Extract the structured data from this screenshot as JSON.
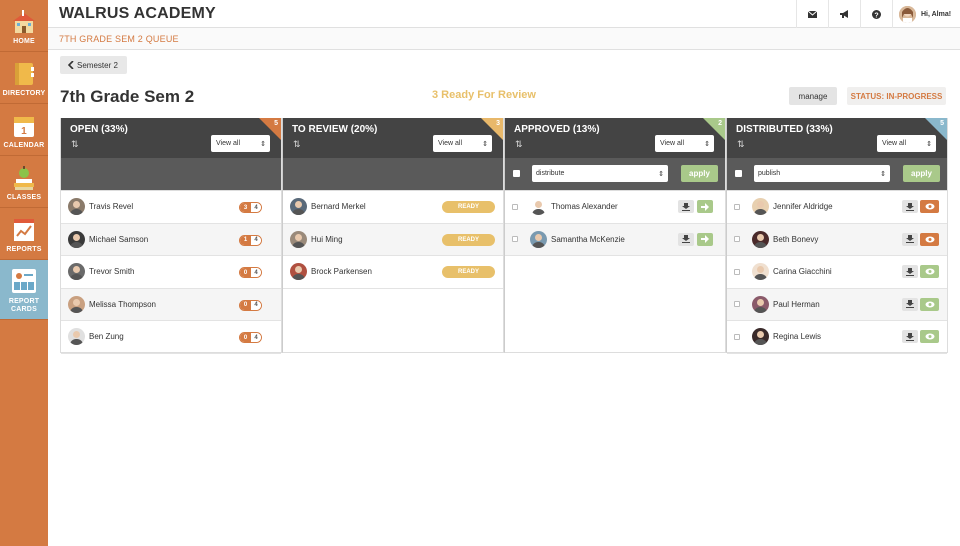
{
  "sidebar": {
    "items": [
      {
        "label": "HOME",
        "icon": "school-icon"
      },
      {
        "label": "DIRECTORY",
        "icon": "directory-icon"
      },
      {
        "label": "CALENDAR",
        "icon": "calendar-icon",
        "day": "1"
      },
      {
        "label": "CLASSES",
        "icon": "classes-icon"
      },
      {
        "label": "REPORTS",
        "icon": "reports-icon"
      },
      {
        "label": "REPORT CARDS",
        "icon": "report-cards-icon"
      }
    ]
  },
  "header": {
    "brand": "WALRUS ACADEMY",
    "greeting": "Hi, Alma!",
    "icons": [
      "mail-icon",
      "megaphone-icon",
      "help-icon"
    ]
  },
  "breadcrumb": "7TH GRADE SEM 2 QUEUE",
  "back_label": "Semester 2",
  "page_title": "7th Grade Sem 2",
  "ready_text": "3 Ready For Review",
  "manage_label": "manage",
  "status_label": "STATUS: IN-PROGRESS",
  "colors": {
    "accent": "#d47a42",
    "ready": "#e8c06a",
    "approved": "#a9c98a",
    "distributed": "#8ab8cc"
  },
  "columns": [
    {
      "title": "OPEN (33%)",
      "count": "5",
      "view": "View all",
      "rows": [
        {
          "name": "Travis Revel",
          "done": "3",
          "total": "4"
        },
        {
          "name": "Michael Samson",
          "done": "1",
          "total": "4"
        },
        {
          "name": "Trevor Smith",
          "done": "0",
          "total": "4"
        },
        {
          "name": "Melissa Thompson",
          "done": "0",
          "total": "4"
        },
        {
          "name": "Ben Zung",
          "done": "0",
          "total": "4"
        }
      ]
    },
    {
      "title": "TO REVIEW (20%)",
      "count": "3",
      "view": "View all",
      "rows": [
        {
          "name": "Bernard Merkel",
          "badge": "READY"
        },
        {
          "name": "Hui Ming",
          "badge": "READY"
        },
        {
          "name": "Brock Parkensen",
          "badge": "READY"
        }
      ]
    },
    {
      "title": "APPROVED (13%)",
      "count": "2",
      "view": "View all",
      "action": "distribute",
      "apply": "apply",
      "rows": [
        {
          "name": "Thomas Alexander"
        },
        {
          "name": "Samantha McKenzie"
        }
      ]
    },
    {
      "title": "DISTRIBUTED (33%)",
      "count": "5",
      "view": "View all",
      "action": "publish",
      "apply": "apply",
      "rows": [
        {
          "name": "Jennifer Aldridge",
          "viewed": false
        },
        {
          "name": "Beth Bonevy",
          "viewed": false
        },
        {
          "name": "Carina Giacchini",
          "viewed": true
        },
        {
          "name": "Paul Herman",
          "viewed": true
        },
        {
          "name": "Regina Lewis",
          "viewed": true
        }
      ]
    }
  ]
}
